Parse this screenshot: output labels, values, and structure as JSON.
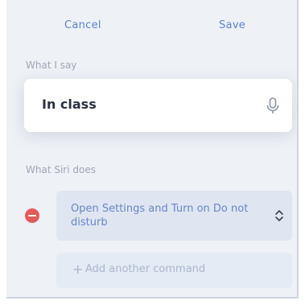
{
  "topbar": {
    "cancel_label": "Cancel",
    "save_label": "Save"
  },
  "say_section": {
    "label": "What I say",
    "phrase": "In class",
    "mic_icon": "microphone-icon"
  },
  "siri_section": {
    "label": "What Siri does",
    "command": "Open Settings and Turn on Do not disturb",
    "remove_icon": "minus-circle-icon",
    "select_icon": "chevron-up-down-icon",
    "add_label": "Add another command",
    "add_icon": "plus-icon"
  },
  "colors": {
    "background": "#eef1f6",
    "accent": "#5c7fd6",
    "danger": "#e25a5a"
  }
}
